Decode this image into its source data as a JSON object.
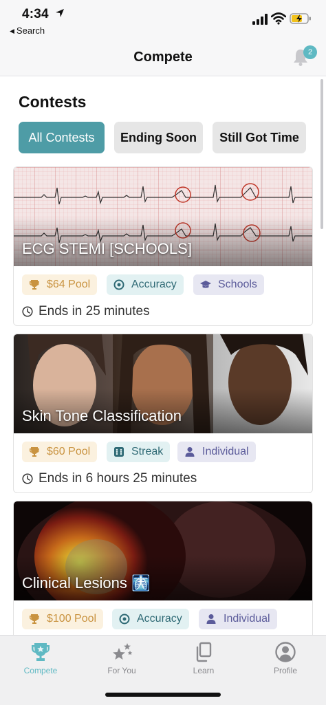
{
  "status_bar": {
    "time": "4:34",
    "back_label": "Search"
  },
  "header": {
    "title": "Compete",
    "notification_count": "2"
  },
  "section": {
    "title": "Contests"
  },
  "filters": [
    {
      "label": "All Contests",
      "active": true
    },
    {
      "label": "Ending Soon",
      "active": false
    },
    {
      "label": "Still Got Time",
      "active": false
    }
  ],
  "contests": [
    {
      "title": "ECG STEMI [SCHOOLS]",
      "pool": "$64 Pool",
      "metric": "Accuracy",
      "group": "Schools",
      "ends": "Ends in 25 minutes"
    },
    {
      "title": "Skin Tone Classification",
      "pool": "$60 Pool",
      "metric": "Streak",
      "group": "Individual",
      "ends": "Ends in 6 hours 25 minutes"
    },
    {
      "title": "Clinical Lesions 🩻",
      "pool": "$100 Pool",
      "metric": "Accuracy",
      "group": "Individual"
    }
  ],
  "tabs": [
    {
      "label": "Compete",
      "icon": "trophy-icon",
      "active": true
    },
    {
      "label": "For You",
      "icon": "stars-icon",
      "active": false
    },
    {
      "label": "Learn",
      "icon": "copy-icon",
      "active": false
    },
    {
      "label": "Profile",
      "icon": "person-circle-icon",
      "active": false
    }
  ],
  "colors": {
    "accent": "#4e9ca6",
    "accent_light": "#5fb9c3",
    "pool_bg": "#fbf1df",
    "pool_text": "#c99340",
    "metric_bg": "#e2f1f2",
    "group_bg": "#e7e7f2"
  }
}
